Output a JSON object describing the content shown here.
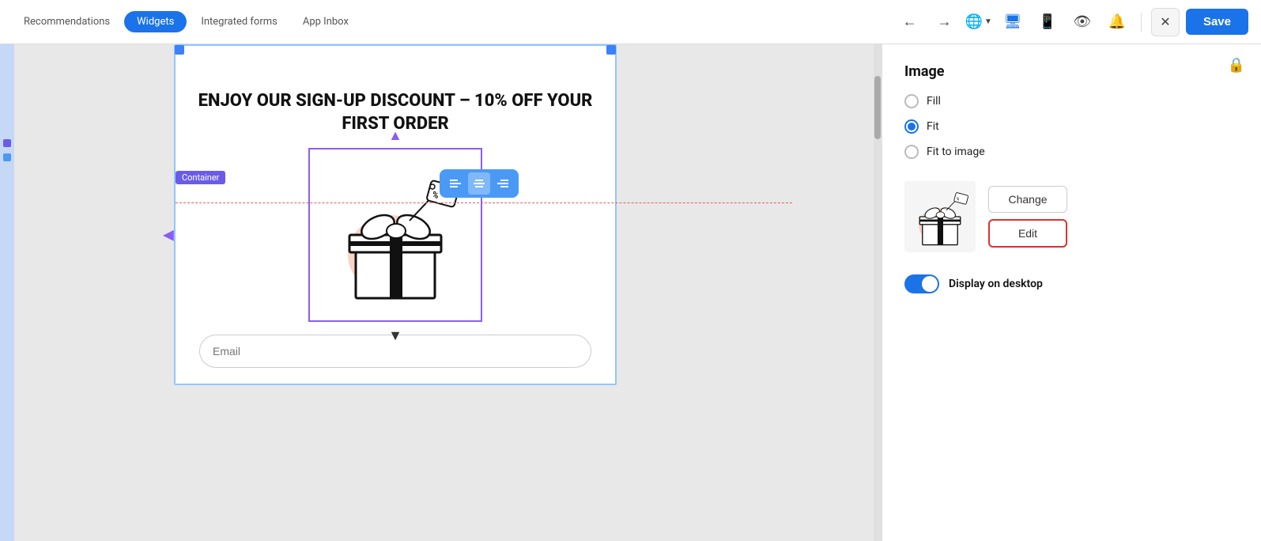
{
  "tabs": {
    "items": [
      {
        "label": "Recommendations",
        "active": false
      },
      {
        "label": "Widgets",
        "active": true
      },
      {
        "label": "Integrated forms",
        "active": false
      },
      {
        "label": "App Inbox",
        "active": false
      }
    ]
  },
  "toolbar": {
    "save_label": "Save"
  },
  "canvas": {
    "container_label": "Container",
    "headline": "ENJOY OUR SIGN-UP DISCOUNT – 10% OFF YOUR FIRST ORDER",
    "email_placeholder": "Email"
  },
  "panel": {
    "title": "Image",
    "fill_label": "Fill",
    "fit_label": "Fit",
    "fit_to_image_label": "Fit to image",
    "change_label": "Change",
    "edit_label": "Edit",
    "display_desktop_label": "Display on desktop",
    "selected_option": "fit"
  }
}
